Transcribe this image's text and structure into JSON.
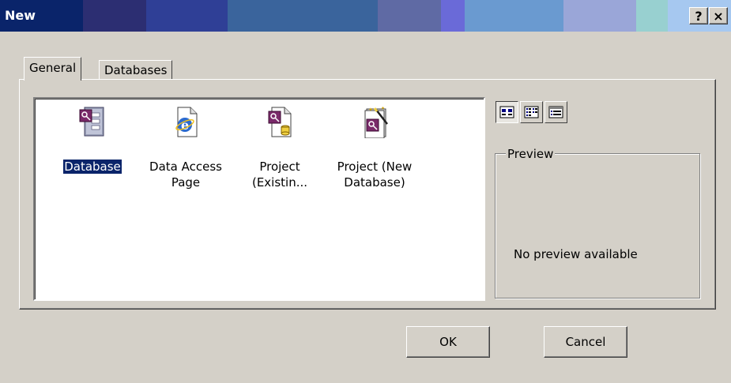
{
  "window": {
    "title": "New",
    "help_btn": "?",
    "close_btn": "×"
  },
  "tabs": [
    {
      "label": "General",
      "active": true
    },
    {
      "label": "Databases",
      "active": false
    }
  ],
  "items": [
    {
      "label_line1": "Database",
      "label_line2": "",
      "icon": "access-database-icon",
      "selected": true
    },
    {
      "label_line1": "Data Access",
      "label_line2": "Page",
      "icon": "data-access-page-icon",
      "selected": false
    },
    {
      "label_line1": "Project",
      "label_line2": "(Existin...",
      "icon": "project-existing-icon",
      "selected": false
    },
    {
      "label_line1": "Project (New",
      "label_line2": "Database)",
      "icon": "project-new-database-icon",
      "selected": false
    }
  ],
  "view_buttons": [
    {
      "name": "large-icons-view",
      "pressed": true
    },
    {
      "name": "list-view",
      "pressed": false
    },
    {
      "name": "details-view",
      "pressed": false
    }
  ],
  "preview": {
    "label": "Preview",
    "message": "No preview available"
  },
  "buttons": {
    "ok": "OK",
    "cancel": "Cancel"
  },
  "colors": {
    "selection": "#0a246a",
    "face": "#d4d0c8",
    "access_purple": "#7a2a6a"
  }
}
